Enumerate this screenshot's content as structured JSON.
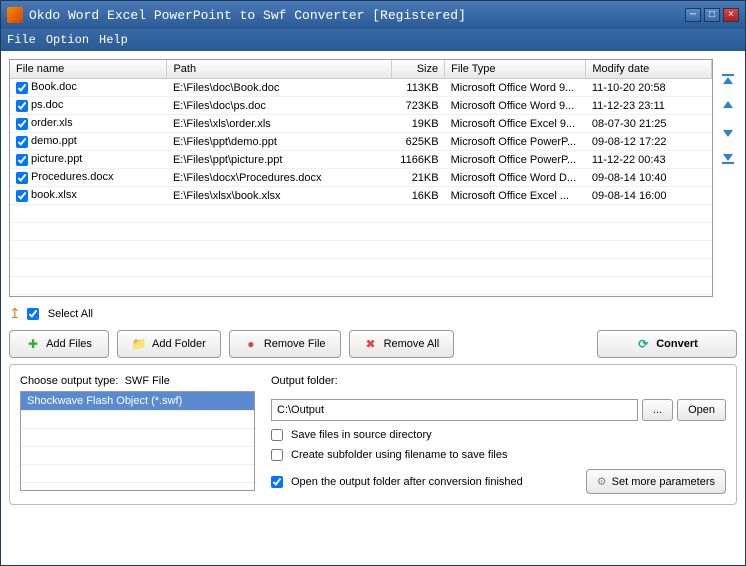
{
  "window": {
    "title": "Okdo Word Excel PowerPoint to Swf Converter [Registered]"
  },
  "menu": {
    "file": "File",
    "option": "Option",
    "help": "Help"
  },
  "table": {
    "headers": {
      "name": "File name",
      "path": "Path",
      "size": "Size",
      "type": "File Type",
      "date": "Modify date"
    },
    "rows": [
      {
        "name": "Book.doc",
        "path": "E:\\Files\\doc\\Book.doc",
        "size": "113KB",
        "type": "Microsoft Office Word 9...",
        "date": "11-10-20 20:58"
      },
      {
        "name": "ps.doc",
        "path": "E:\\Files\\doc\\ps.doc",
        "size": "723KB",
        "type": "Microsoft Office Word 9...",
        "date": "11-12-23 23:11"
      },
      {
        "name": "order.xls",
        "path": "E:\\Files\\xls\\order.xls",
        "size": "19KB",
        "type": "Microsoft Office Excel 9...",
        "date": "08-07-30 21:25"
      },
      {
        "name": "demo.ppt",
        "path": "E:\\Files\\ppt\\demo.ppt",
        "size": "625KB",
        "type": "Microsoft Office PowerP...",
        "date": "09-08-12 17:22"
      },
      {
        "name": "picture.ppt",
        "path": "E:\\Files\\ppt\\picture.ppt",
        "size": "1166KB",
        "type": "Microsoft Office PowerP...",
        "date": "11-12-22 00:43"
      },
      {
        "name": "Procedures.docx",
        "path": "E:\\Files\\docx\\Procedures.docx",
        "size": "21KB",
        "type": "Microsoft Office Word D...",
        "date": "09-08-14 10:40"
      },
      {
        "name": "book.xlsx",
        "path": "E:\\Files\\xlsx\\book.xlsx",
        "size": "16KB",
        "type": "Microsoft Office Excel ...",
        "date": "09-08-14 16:00"
      }
    ]
  },
  "selectAll": "Select All",
  "buttons": {
    "addFiles": "Add Files",
    "addFolder": "Add Folder",
    "removeFile": "Remove File",
    "removeAll": "Remove All",
    "convert": "Convert"
  },
  "output": {
    "typeLabel": "Choose output type:",
    "typeValue": "SWF File",
    "listItem": "Shockwave Flash Object (*.swf)",
    "folderLabel": "Output folder:",
    "folderValue": "C:\\Output",
    "browse": "...",
    "open": "Open",
    "saveSource": "Save files in source directory",
    "createSub": "Create subfolder using filename to save files",
    "openAfter": "Open the output folder after conversion finished",
    "params": "Set more parameters"
  }
}
